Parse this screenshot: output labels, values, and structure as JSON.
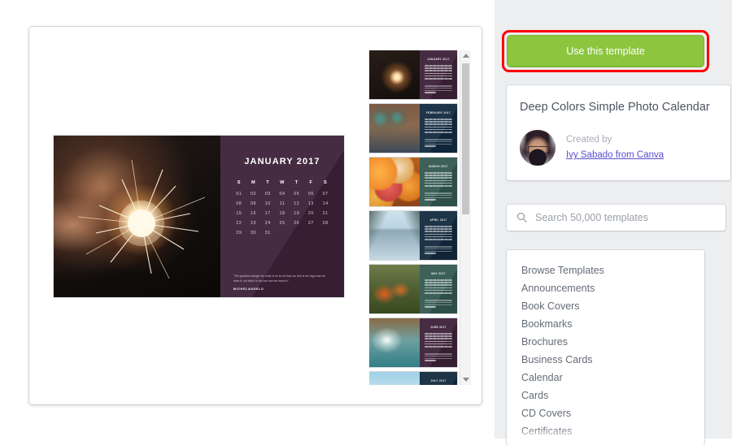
{
  "preview": {
    "spread": {
      "month_label": "JANUARY 2017",
      "dow": [
        "S",
        "M",
        "T",
        "W",
        "T",
        "F",
        "S"
      ],
      "dates": [
        "01",
        "02",
        "03",
        "04",
        "05",
        "06",
        "07",
        "08",
        "09",
        "10",
        "11",
        "12",
        "13",
        "14",
        "15",
        "16",
        "17",
        "18",
        "19",
        "20",
        "21",
        "22",
        "23",
        "24",
        "25",
        "26",
        "27",
        "28",
        "29",
        "30",
        "31"
      ],
      "quote": "\"The greatest danger for most of us is not that our aim is too high and we miss it, but that it is too low and we reach it.\"",
      "author": "MICHELANGELO",
      "photo_name": "sparkler-photo",
      "panel_color": "#3c2139"
    },
    "thumbnails": [
      {
        "month": "JANUARY 2017",
        "panel_color": "#3c2139",
        "photo": "ph-sparkler",
        "photo_name": "sparkler-thumb"
      },
      {
        "month": "FEBRUARY 2017",
        "panel_color": "#11293f",
        "photo": "ph-cafe",
        "photo_name": "cafe-thumb"
      },
      {
        "month": "MARCH 2017",
        "panel_color": "#33584f",
        "photo": "ph-citrus",
        "photo_name": "citrus-thumb"
      },
      {
        "month": "APRIL 2017",
        "panel_color": "#12293d",
        "photo": "ph-lake",
        "photo_name": "lake-thumb"
      },
      {
        "month": "MAY 2017",
        "panel_color": "#33584f",
        "photo": "ph-tulips",
        "photo_name": "tulips-thumb"
      },
      {
        "month": "JUNE 2017",
        "panel_color": "#3c2139",
        "photo": "ph-surf",
        "photo_name": "surfer-thumb"
      },
      {
        "month": "JULY 2017",
        "panel_color": "#12293d",
        "photo": "ph-beach",
        "photo_name": "beach-thumb"
      }
    ],
    "scrollbar": {
      "up_arrow": "scroll-up-arrow",
      "down_arrow": "scroll-down-arrow"
    }
  },
  "sidebar": {
    "cta": {
      "label": "Use this template",
      "color": "#8cc63e",
      "highlight_color": "#ff0000"
    },
    "template": {
      "title": "Deep Colors Simple Photo Calendar",
      "created_by_label": "Created by",
      "creator_link": "Ivy Sabado from Canva",
      "creator_link_color": "#5b4bd0"
    },
    "search": {
      "placeholder": "Search 50,000 templates",
      "icon": "search-icon"
    },
    "nav_items": [
      "Browse Templates",
      "Announcements",
      "Book Covers",
      "Bookmarks",
      "Brochures",
      "Business Cards",
      "Calendar",
      "Cards",
      "CD Covers",
      "Certificates"
    ]
  }
}
